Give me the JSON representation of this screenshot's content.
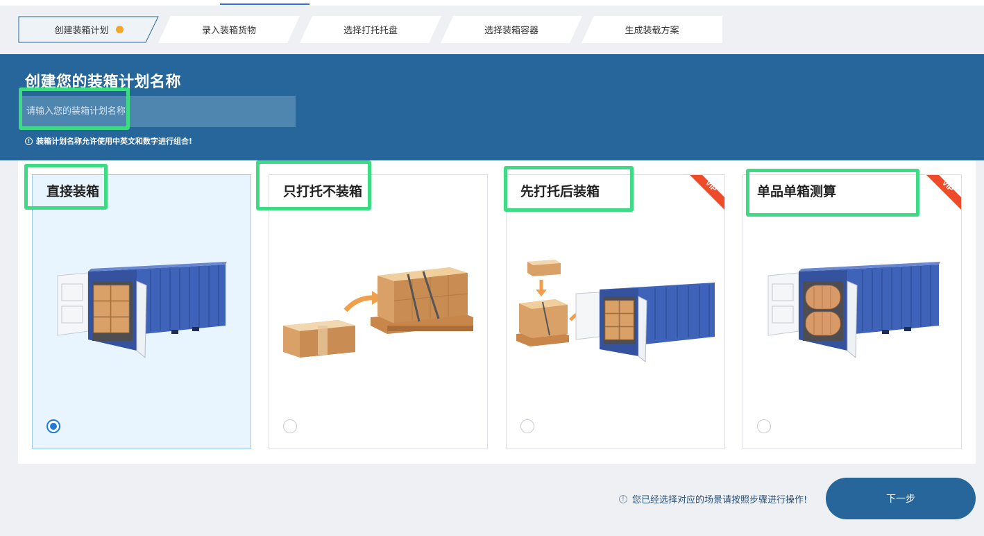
{
  "steps": [
    {
      "label": "创建装箱计划",
      "active": true
    },
    {
      "label": "录入装箱货物"
    },
    {
      "label": "选择打托托盘"
    },
    {
      "label": "选择装箱容器"
    },
    {
      "label": "生成装载方案"
    }
  ],
  "banner": {
    "title": "创建您的装箱计划名称",
    "input_placeholder": "请输入您的装箱计划名称",
    "input_value": "",
    "hint": "装箱计划名称允许使用中英文和数字进行组合!"
  },
  "scenarios": [
    {
      "title": "直接装箱",
      "selected": true,
      "vip": false
    },
    {
      "title": "只打托不装箱",
      "selected": false,
      "vip": false
    },
    {
      "title": "先打托后装箱",
      "selected": false,
      "vip": true,
      "badge": "VIP"
    },
    {
      "title": "单品单箱测算",
      "selected": false,
      "vip": true,
      "badge": "VIP"
    }
  ],
  "footer": {
    "message": "您已经选择对应的场景请按照步骤进行操作!",
    "next_label": "下一步"
  },
  "colors": {
    "primary": "#27669a",
    "step_active_dot": "#f5a623",
    "selected_card_bg": "#e8f4fe",
    "radio_checked": "#1f7ad6",
    "vip_ribbon": "#ee4b2b",
    "highlight_box": "#3ddc84"
  }
}
